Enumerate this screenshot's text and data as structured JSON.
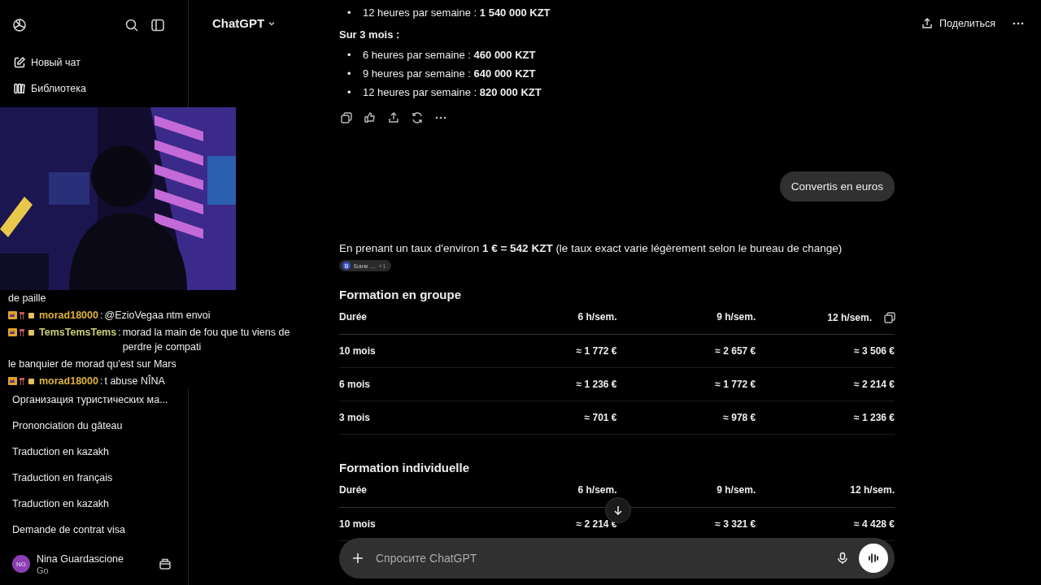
{
  "sidebar": {
    "nav": [
      {
        "label": "Новый чат"
      },
      {
        "label": "Библиотека"
      }
    ],
    "chats": [
      "Организация туристических ма...",
      "Prononciation du gâteau",
      "Traduction en kazakh",
      "Traduction en français",
      "Traduction en kazakh",
      "Demande de contrat visa"
    ],
    "user": {
      "initials": "NG",
      "name": "Nina Guardascione",
      "plan": "Go"
    }
  },
  "stream_overlay": {
    "messages": [
      {
        "text": "de paille"
      },
      {
        "user": "morad18000",
        "color": "#e0b23a",
        "separator": ":",
        "text": "@EzioVegaa ntm envoi"
      },
      {
        "user": "TemsTemsTems",
        "color": "#c9cf7a",
        "separator": ":",
        "text": "morad la main de fou que tu viens de perdre je compati"
      },
      {
        "text": "le banquier de morad qu'est sur Mars"
      },
      {
        "user": "morad18000",
        "color": "#e0b23a",
        "separator": ":",
        "text": "t abuse NÎNA"
      }
    ]
  },
  "header": {
    "title": "ChatGPT",
    "share": "Поделиться"
  },
  "conversation": {
    "bullets_top": [
      {
        "marker": "•",
        "text": "12 heures par semaine : **1 540 000 KZT**"
      }
    ],
    "section_title": "Sur 3 mois :",
    "bullets": [
      {
        "marker": "•",
        "text": "6 heures par semaine : **460 000 KZT**"
      },
      {
        "marker": "•",
        "text": "9 heures par semaine : **640 000 KZT**"
      },
      {
        "marker": "•",
        "text": "12 heures par semaine : **820 000 KZT**"
      }
    ],
    "user_message": "Convertis en euros",
    "answer_intro": "En prenant un taux d'environ **1 € = 542 KZT** (le taux exact varie légèrement selon le bureau de change)",
    "source_chip": {
      "initial": "B",
      "label": "Банк ...",
      "more": "+1"
    },
    "tables": [
      {
        "title": "Formation en groupe",
        "columns": [
          "Durée",
          "6 h/sem.",
          "9 h/sem.",
          "12 h/sem."
        ],
        "rows": [
          [
            "10 mois",
            "≈ 1 772 €",
            "≈ 2 657 €",
            "≈ 3 506 €"
          ],
          [
            "6 mois",
            "≈ 1 236 €",
            "≈ 1 772 €",
            "≈ 2 214 €"
          ],
          [
            "3 mois",
            "≈ 701 €",
            "≈ 978 €",
            "≈ 1 236 €"
          ]
        ]
      },
      {
        "title": "Formation individuelle",
        "columns": [
          "Durée",
          "6 h/sem.",
          "9 h/sem.",
          "12 h/sem."
        ],
        "rows": [
          [
            "10 mois",
            "≈ 2 214 €",
            "≈ 3 321 €",
            "≈ 4 428 €"
          ]
        ]
      }
    ]
  },
  "composer": {
    "placeholder": "Спросите ChatGPT"
  }
}
